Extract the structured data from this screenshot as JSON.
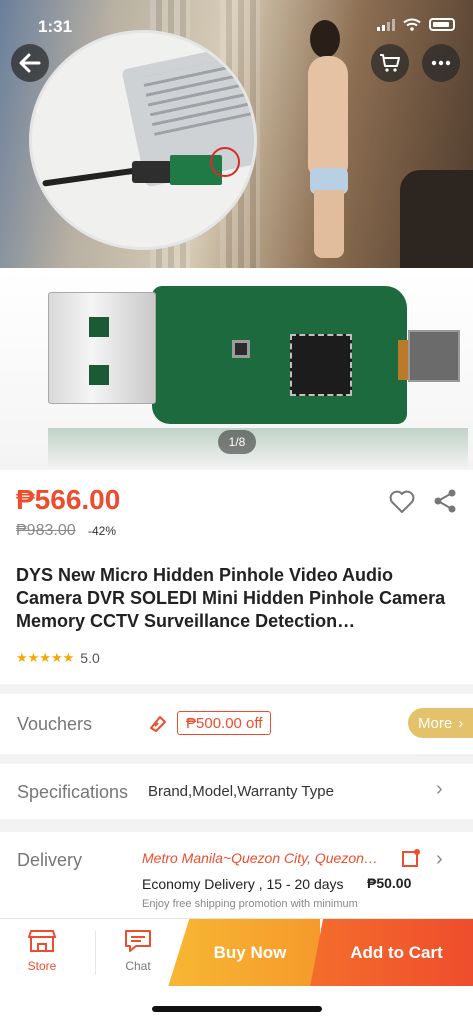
{
  "status_bar": {
    "time": "1:31"
  },
  "hero": {
    "pager": "1/8"
  },
  "product": {
    "price": "₱566.00",
    "original_price": "₱983.00",
    "discount": "-42%",
    "title": "DYS New Micro Hidden Pinhole Video Audio Camera DVR SOLEDI Mini Hidden Pinhole Camera Memory CCTV Surveillance Detection…",
    "rating": "5.0",
    "stars": "★★★★★"
  },
  "vouchers": {
    "label": "Vouchers",
    "chip": "₱500.00 off",
    "more": "More"
  },
  "specifications": {
    "label": "Specifications",
    "value": "Brand,Model,Warranty Type"
  },
  "delivery": {
    "label": "Delivery",
    "location": "Metro Manila~Quezon City, Quezon…",
    "method": "Economy Delivery , 15 - 20 days",
    "fee": "₱50.00",
    "promo": "Enjoy free shipping promotion with minimum"
  },
  "bottom_bar": {
    "store": "Store",
    "chat": "Chat",
    "buy_now": "Buy Now",
    "add_to_cart": "Add to Cart"
  },
  "colors": {
    "accent": "#ee4d2d",
    "buy_now": "#f7b733",
    "stars": "#f6a700",
    "more_pill": "#e3c26b"
  },
  "icons": [
    "back-arrow-icon",
    "cart-icon",
    "more-icon",
    "heart-icon",
    "share-icon",
    "ticket-icon",
    "chevron-right-icon",
    "edit-location-icon",
    "store-icon",
    "chat-icon"
  ]
}
